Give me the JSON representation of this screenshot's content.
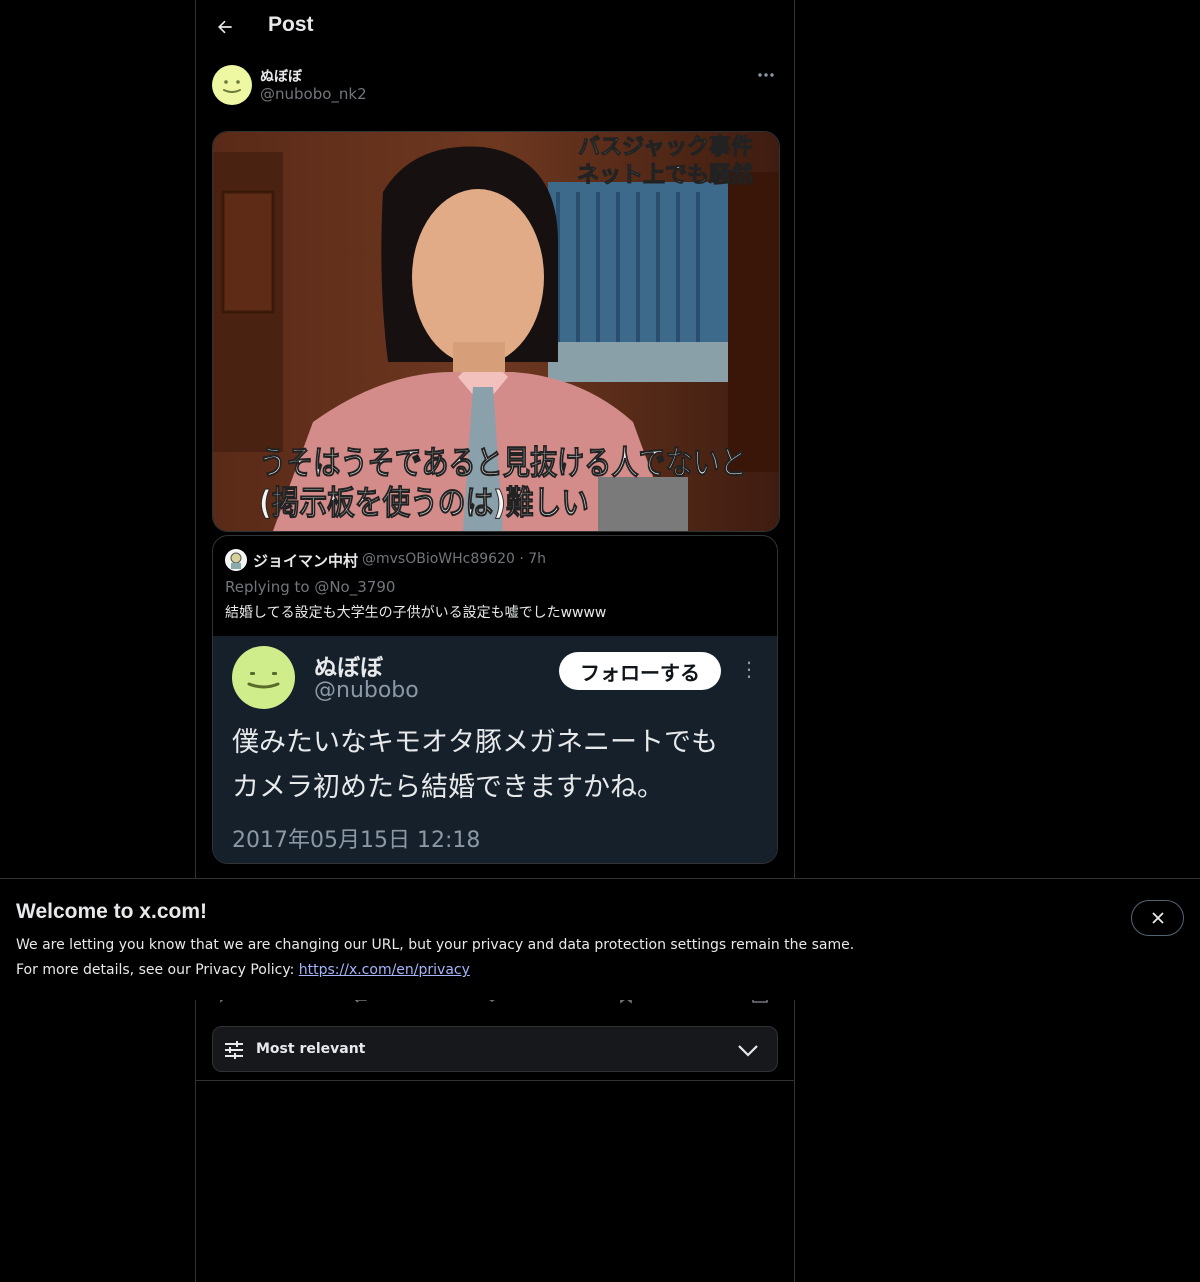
{
  "header": {
    "title": "Post"
  },
  "author": {
    "name": "ぬぼぼ",
    "handle": "@nubobo_nk2"
  },
  "media": {
    "caption_top_line1": "バスジャック事件",
    "caption_top_line2": "ネット上でも騒然",
    "caption_bottom_line1": "うそはうそであると見抜ける人でないと",
    "caption_bottom_line2": "(掲示板を使うのは)難しい"
  },
  "quote": {
    "name": "ジョイマン中村",
    "handle": "@mvsOBioWHc89620 · 7h",
    "replying": "Replying to @No_3790",
    "text": "結婚してる設定も大学生の子供がいる設定も嘘でしたwwww",
    "image": {
      "name": "ぬぼぼ",
      "handle": "@nubobo",
      "follow_label": "フォローする",
      "text_line1": "僕みたいなキモオタ豚メガネニートでも",
      "text_line2": "カメラ初めたら結婚できますかね。",
      "date": "2017年05月15日 12:18"
    }
  },
  "sort": {
    "label": "Most relevant"
  },
  "banner": {
    "title": "Welcome to x.com!",
    "line1": "We are letting you know that we are changing our URL, but your privacy and data protection settings remain the same.",
    "line2_prefix": "For more details, see our Privacy Policy: ",
    "link": "https://x.com/en/privacy"
  },
  "colors": {
    "background": "#000000",
    "border": "#2f3336",
    "muted": "#71767b",
    "link": "#a5b4fc",
    "avatar": "#eef7a1"
  }
}
